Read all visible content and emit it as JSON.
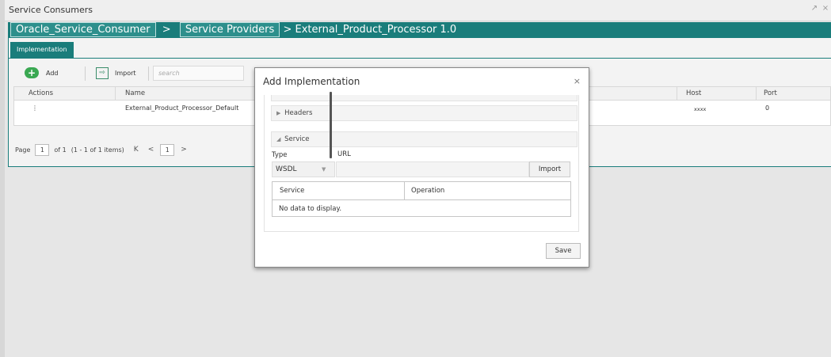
{
  "window": {
    "title": "Service Consumers",
    "controls": [
      "↗",
      "×"
    ]
  },
  "breadcrumb": {
    "items": [
      "Oracle_Service_Consumer",
      "Service Providers"
    ],
    "separator": ">",
    "current": "> External_Product_Processor 1.0"
  },
  "tabs": [
    {
      "label": "Implementation"
    }
  ],
  "toolbar": {
    "add_label": "Add",
    "import_label": "Import",
    "search_placeholder": "search"
  },
  "grid": {
    "columns": [
      "Actions",
      "Name",
      "Host",
      "Port"
    ],
    "rows": [
      {
        "actions": "⋮",
        "name": "External_Product_Processor_Default",
        "host": "xxxx",
        "port": "0"
      }
    ]
  },
  "pager": {
    "page_label": "Page",
    "page": "1",
    "of_label": "of 1",
    "items_info": "(1 - 1 of 1 items)",
    "first": "K",
    "prev": "<",
    "current": "1",
    "next": ">"
  },
  "modal": {
    "title": "Add Implementation",
    "close": "×",
    "headers_label": "Headers",
    "service_label": "Service",
    "type_label": "Type",
    "url_label": "URL",
    "type_value": "WSDL",
    "import_label": "Import",
    "table_columns": [
      "Service",
      "Operation"
    ],
    "empty_text": "No data to display.",
    "save_label": "Save"
  },
  "colors": {
    "accent": "#1a7d7b",
    "add_green": "#3aa852"
  }
}
